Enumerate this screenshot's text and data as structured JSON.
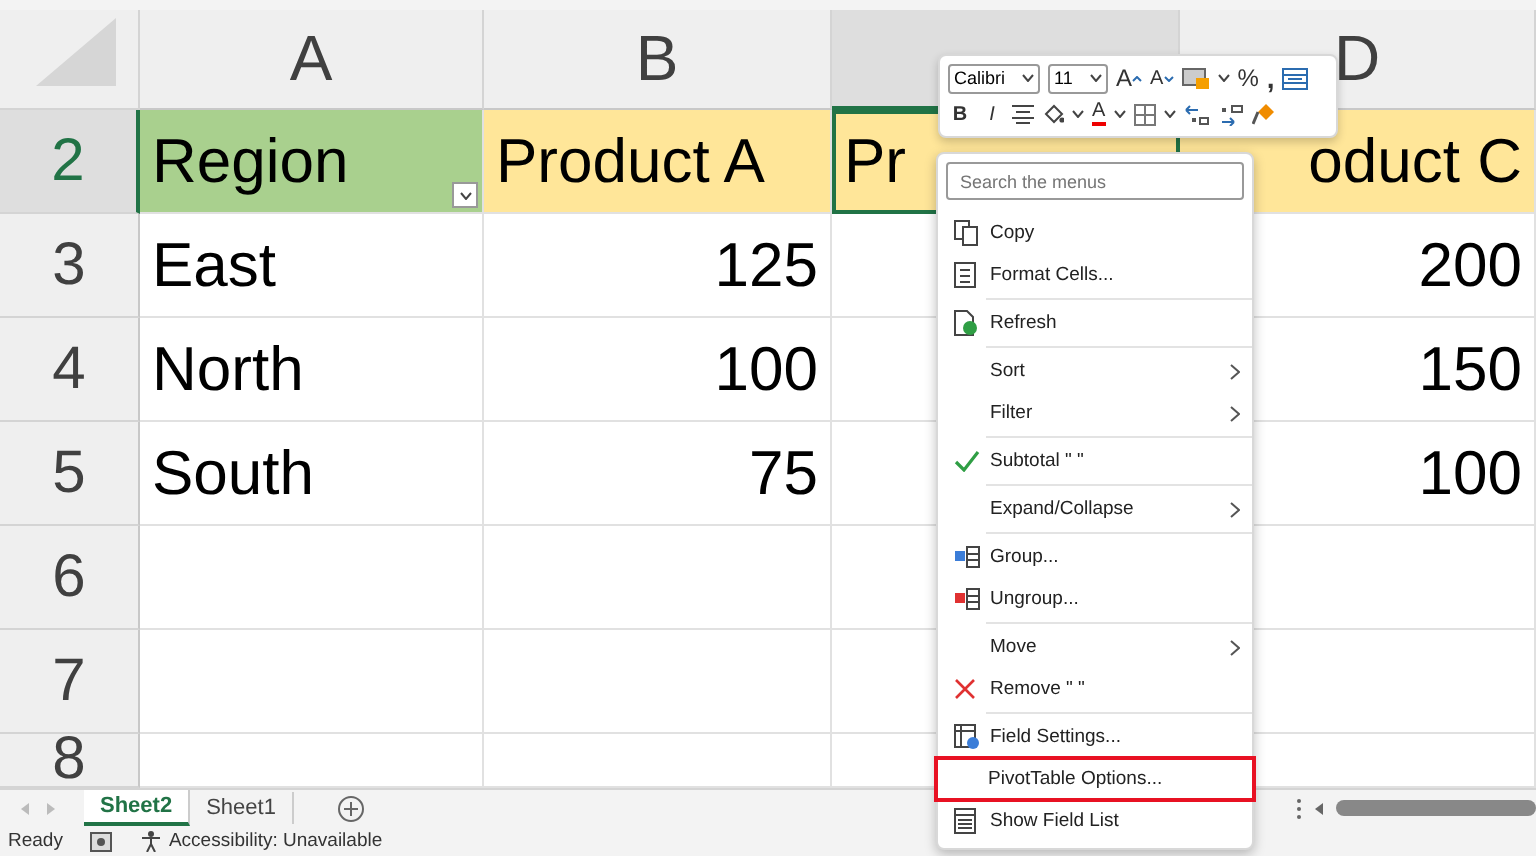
{
  "columns": [
    {
      "label": "A",
      "selected": false
    },
    {
      "label": "B",
      "selected": false
    },
    {
      "selected": true
    },
    {
      "label": "D",
      "selected": false
    }
  ],
  "rows": [
    {
      "number": "2",
      "selected": true,
      "cells": [
        {
          "kind": "row-label",
          "text": "Region"
        },
        {
          "kind": "column-label",
          "text": "Product A"
        },
        {
          "kind": "column-label",
          "text": "Pr",
          "selected": true
        },
        {
          "kind": "column-label",
          "text": "oduct C"
        }
      ]
    },
    {
      "number": "3",
      "selected": false,
      "cells": [
        {
          "kind": "text",
          "text": "East"
        },
        {
          "kind": "number",
          "text": "125"
        },
        {
          "kind": "blank"
        },
        {
          "kind": "number",
          "text": "200"
        }
      ]
    },
    {
      "number": "4",
      "selected": false,
      "cells": [
        {
          "kind": "text",
          "text": "North"
        },
        {
          "kind": "number",
          "text": "100"
        },
        {
          "kind": "blank"
        },
        {
          "kind": "number",
          "text": "150"
        }
      ]
    },
    {
      "number": "5",
      "selected": false,
      "cells": [
        {
          "kind": "text",
          "text": "South"
        },
        {
          "kind": "number",
          "text": "75"
        },
        {
          "kind": "blank"
        },
        {
          "kind": "number",
          "text": "100"
        }
      ]
    },
    {
      "number": "6",
      "selected": false
    },
    {
      "number": "7",
      "selected": false
    },
    {
      "number": "8",
      "selected": false
    }
  ],
  "mini_toolbar": {
    "font": "Calibri",
    "size": "11",
    "glyphs": [
      "A",
      "A",
      "%",
      ",",
      "B",
      "I",
      "A"
    ]
  },
  "context_menu": {
    "search": {
      "placeholder": "Search the menus"
    },
    "groups": [
      [
        {
          "label": "Copy",
          "checked": false,
          "submenu": false,
          "highlighted": false
        },
        {
          "label": "Format Cells...",
          "checked": false,
          "submenu": false,
          "highlighted": false
        }
      ],
      [
        {
          "label": "Refresh",
          "checked": false,
          "submenu": false,
          "highlighted": false
        }
      ],
      [
        {
          "label": "Sort",
          "checked": false,
          "submenu": true,
          "highlighted": false
        },
        {
          "label": "Filter",
          "checked": false,
          "submenu": true,
          "highlighted": false
        }
      ],
      [
        {
          "label": "Subtotal \" \"",
          "checked": true,
          "submenu": false,
          "highlighted": false
        }
      ],
      [
        {
          "label": "Expand/Collapse",
          "checked": false,
          "submenu": true,
          "highlighted": false
        }
      ],
      [
        {
          "label": "Group...",
          "checked": false,
          "submenu": false,
          "highlighted": false
        },
        {
          "label": "Ungroup...",
          "checked": false,
          "submenu": false,
          "highlighted": false
        }
      ],
      [
        {
          "label": "Move",
          "checked": false,
          "submenu": true,
          "highlighted": false
        },
        {
          "label": "Remove \" \"",
          "checked": false,
          "submenu": false,
          "highlighted": false
        }
      ],
      [
        {
          "label": "Field Settings...",
          "checked": false,
          "submenu": false,
          "highlighted": false
        },
        {
          "label": "PivotTable Options...",
          "checked": false,
          "submenu": false,
          "highlighted": true
        },
        {
          "label": "Show Field List",
          "checked": false,
          "submenu": false,
          "highlighted": false
        }
      ]
    ]
  },
  "sheet_tabs": [
    {
      "label": "Sheet2",
      "selected": true
    },
    {
      "label": "Sheet1",
      "selected": false
    }
  ],
  "status_bar": {
    "mode": "Ready",
    "accessibility": "Accessibility: Unavailable"
  }
}
